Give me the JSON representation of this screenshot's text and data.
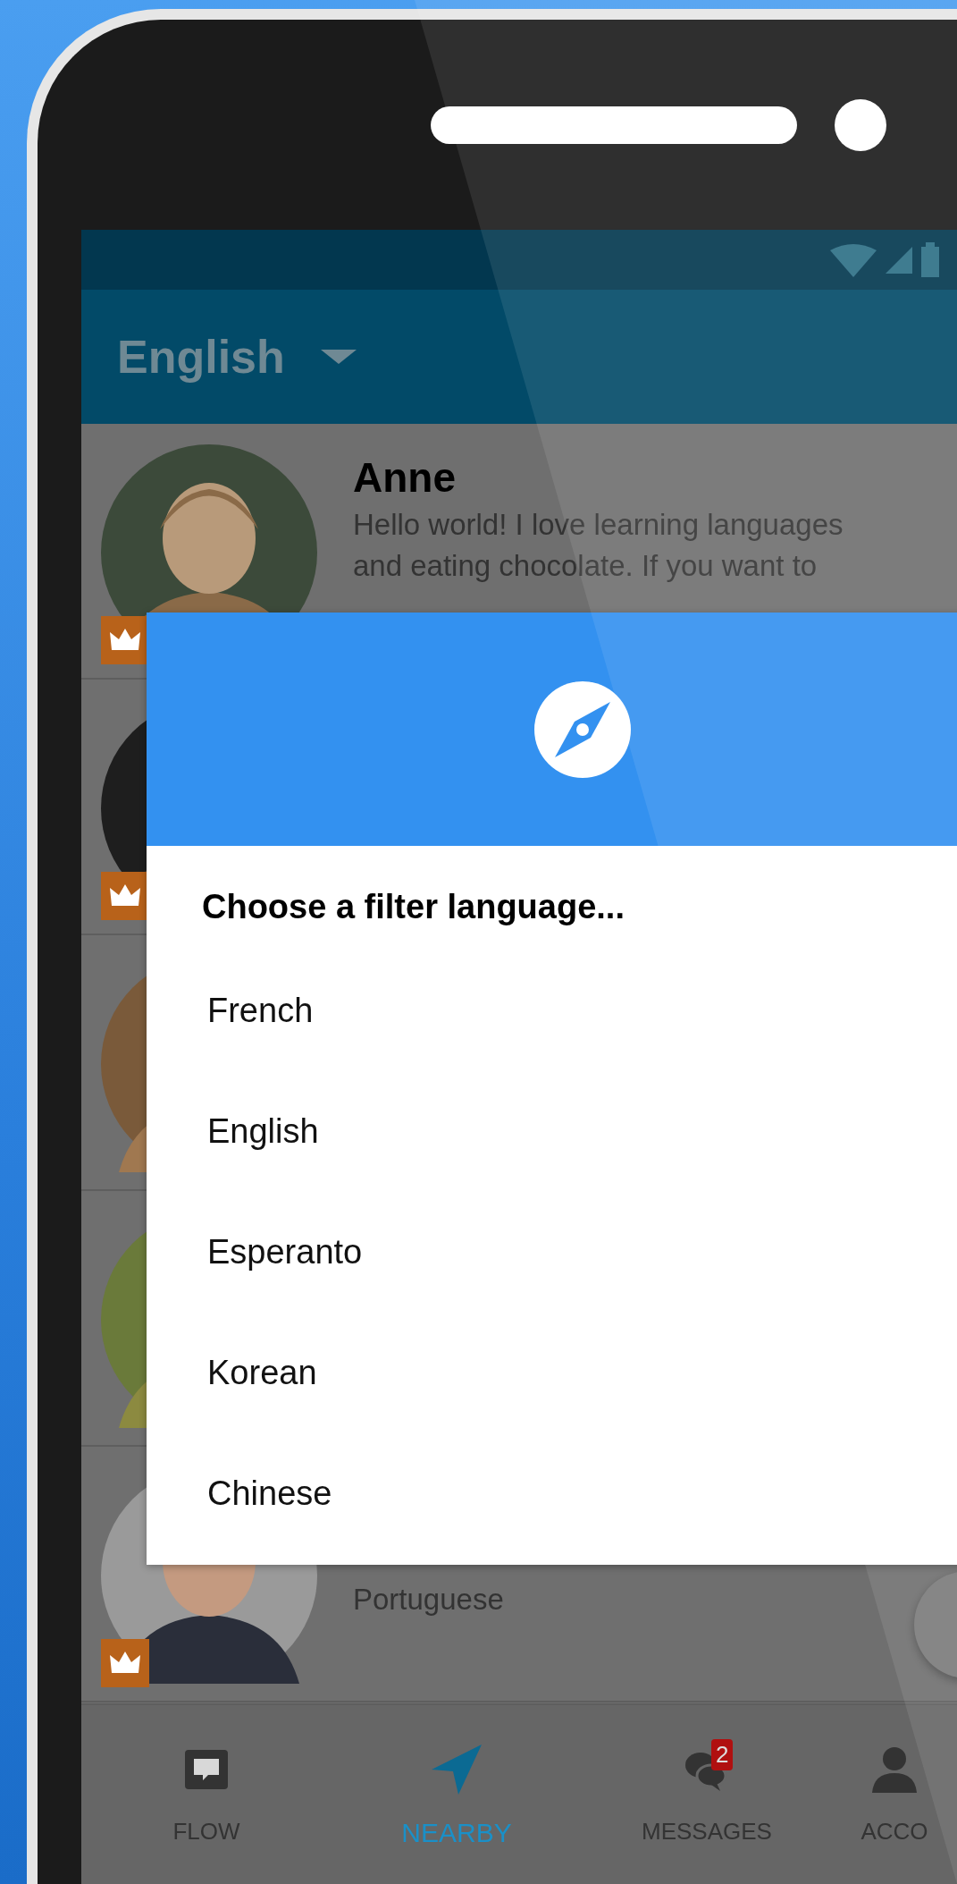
{
  "app_bar": {
    "title": "English"
  },
  "users": [
    {
      "name": "Anne",
      "bio_lines": [
        "Hello world! I love learning languages",
        "and eating chocolate. If you want to"
      ],
      "premium": true
    },
    {
      "premium": true
    },
    {
      "premium": false
    },
    {
      "premium": false
    },
    {
      "bio_lines": [
        "Portuguese"
      ],
      "premium": true
    }
  ],
  "dialog": {
    "title": "Choose a filter language...",
    "options": [
      "French",
      "English",
      "Esperanto",
      "Korean",
      "Chinese"
    ]
  },
  "bottom_nav": [
    {
      "kind": "flow",
      "label": "FLOW",
      "selected": false
    },
    {
      "kind": "nearby",
      "label": "NEARBY",
      "selected": true
    },
    {
      "kind": "messages",
      "label": "MESSAGES",
      "badge": "2",
      "selected": false
    },
    {
      "kind": "account",
      "label": "ACCO",
      "selected": false
    }
  ]
}
